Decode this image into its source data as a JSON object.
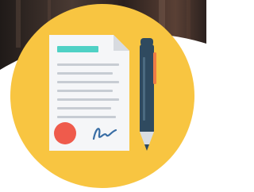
{
  "colors": {
    "background_photo_dark": "#2a1f1c",
    "background_photo_mid": "#5a4035",
    "curve_white": "#ffffff",
    "circle_yellow": "#f8c541",
    "paper": "#f5f6f8",
    "paper_fold": "#d8dbe0",
    "paper_lines": "#c7ccd3",
    "title_bar": "#4fd1c5",
    "seal": "#ef5b4c",
    "signature": "#3a6ea5",
    "pen_body": "#2f4a5f",
    "pen_clip": "#ef7b45",
    "pen_tip": "#d9dde2"
  },
  "icons": [
    "document-icon",
    "pen-icon",
    "seal-icon",
    "signature-icon"
  ]
}
